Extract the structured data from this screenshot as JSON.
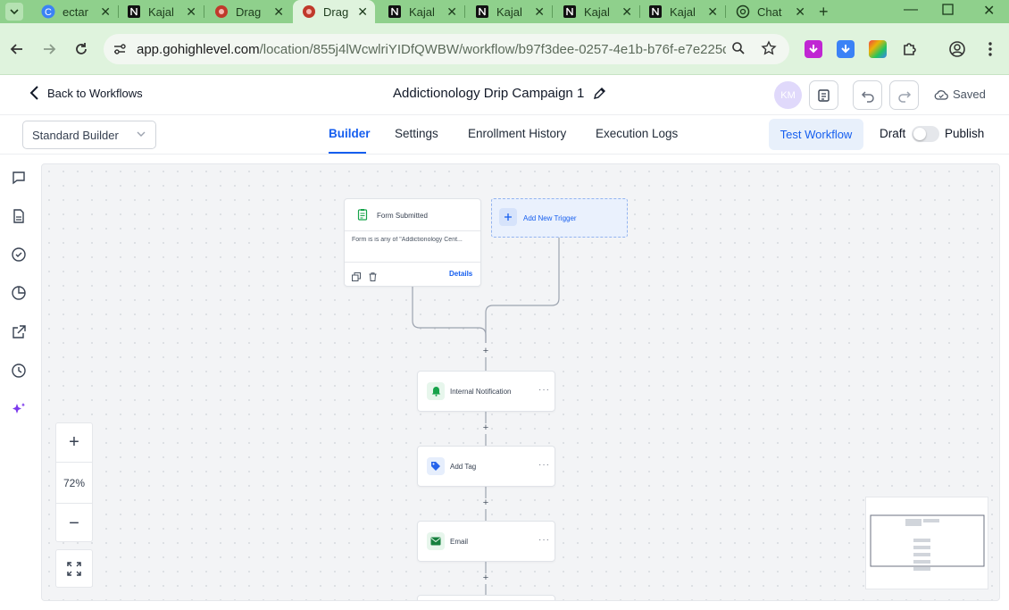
{
  "browser": {
    "tabs": [
      {
        "title": "ectar",
        "icon": "c-logo-icon"
      },
      {
        "title": "Kajal",
        "icon": "notion-icon"
      },
      {
        "title": "Drag",
        "icon": "drag-app-icon"
      },
      {
        "title": "Drag",
        "icon": "drag-app-icon",
        "active": true
      },
      {
        "title": "Kajal",
        "icon": "notion-icon"
      },
      {
        "title": "Kajal",
        "icon": "notion-icon"
      },
      {
        "title": "Kajal",
        "icon": "notion-icon"
      },
      {
        "title": "Kajal",
        "icon": "notion-icon"
      },
      {
        "title": "Chat",
        "icon": "chatgpt-icon"
      }
    ],
    "url_host": "app.gohighlevel.com",
    "url_path": "/location/855j4lWcwlriYIDfQWBW/workflow/b97f3dee-0257-4e1b-b76f-e7e225d7e..."
  },
  "header": {
    "back_label": "Back to Workflows",
    "workflow_title": "Addictionology Drip Campaign 1",
    "avatar_initials": "KM",
    "saved_label": "Saved"
  },
  "subheader": {
    "builder_mode": "Standard Builder",
    "tabs": [
      "Builder",
      "Settings",
      "Enrollment History",
      "Execution Logs"
    ],
    "active_tab": "Builder",
    "test_button": "Test Workflow",
    "draft_label": "Draft",
    "publish_label": "Publish"
  },
  "canvas": {
    "trigger": {
      "title": "Form Submitted",
      "description": "Form is is any of \"Addictionology Cent...",
      "details_link": "Details"
    },
    "add_trigger": "Add New Trigger",
    "actions": [
      {
        "label": "Internal Notification",
        "icon": "bell-icon",
        "color": "#16a34a"
      },
      {
        "label": "Add Tag",
        "icon": "tag-icon",
        "color": "#2563eb"
      },
      {
        "label": "Email",
        "icon": "envelope-icon",
        "color": "#15803d"
      }
    ],
    "zoom_level": "72%"
  },
  "colors": {
    "accent": "#155eef",
    "browser_tabbar": "#8fd08c",
    "browser_toolbar": "#dff3dd"
  }
}
